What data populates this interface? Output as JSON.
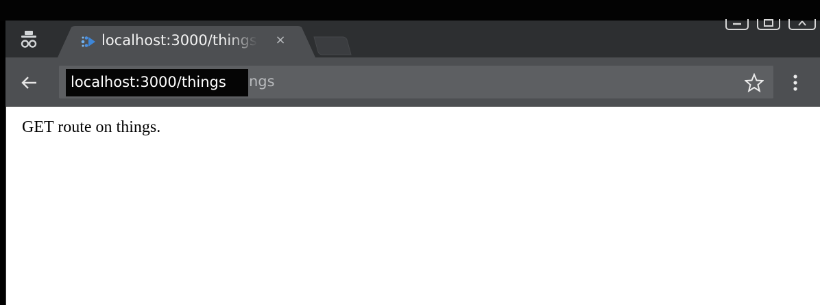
{
  "window": {
    "controls": [
      "minimize",
      "maximize",
      "close"
    ]
  },
  "tab": {
    "title": "localhost:3000/things",
    "close_glyph": "×",
    "favicon": "puzzle-icon",
    "favicon_color": "#4a90e2"
  },
  "toolbar": {
    "back_glyph": "←",
    "omnibox_visible_text": "ost:3000/things",
    "tooltip_text": "localhost:3000/things",
    "star_icon": "star-outline-icon",
    "menu_icon": "vertical-dots-icon"
  },
  "page": {
    "body_text": "GET route on things."
  },
  "colors": {
    "chrome_dark": "#2d2f31",
    "toolbar": "#4d4f52",
    "omnibox": "#5d5f62",
    "page_bg": "#ffffff"
  }
}
